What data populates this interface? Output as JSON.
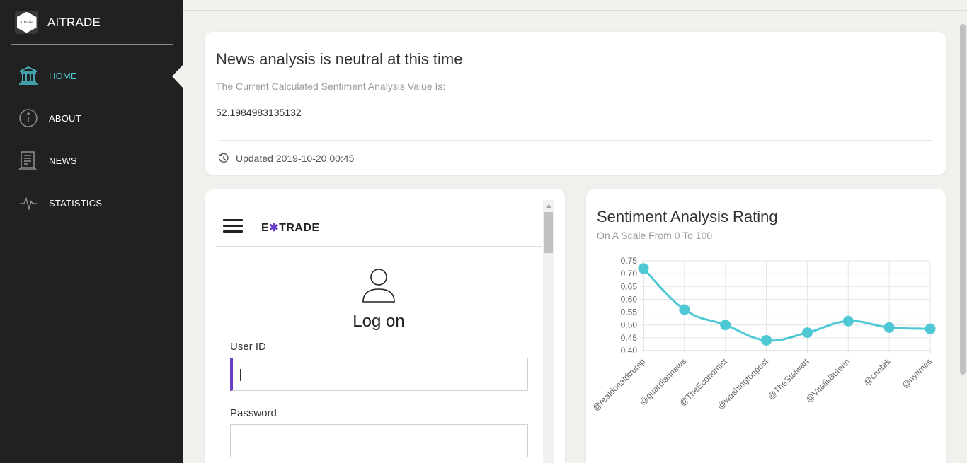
{
  "brand": {
    "name": "AITRADE",
    "logo_text": "AItrade"
  },
  "nav": [
    {
      "label": "HOME",
      "icon": "bank-icon",
      "active": true
    },
    {
      "label": "ABOUT",
      "icon": "info-icon",
      "active": false
    },
    {
      "label": "NEWS",
      "icon": "newspaper-icon",
      "active": false
    },
    {
      "label": "STATISTICS",
      "icon": "pulse-icon",
      "active": false
    }
  ],
  "news_card": {
    "title": "News analysis is neutral at this time",
    "subtitle": "The Current Calculated Sentiment Analysis Value Is:",
    "value": "52.1984983135132",
    "updated": "Updated 2019-10-20 00:45"
  },
  "login_frame": {
    "logo_prefix": "E",
    "logo_star": "✱",
    "logo_suffix": "TRADE",
    "title": "Log on",
    "user_id_label": "User ID",
    "user_id_value": "",
    "password_label": "Password",
    "password_value": ""
  },
  "chart_card": {
    "title": "Sentiment Analysis Rating",
    "subtitle": "On A Scale From 0 To 100"
  },
  "colors": {
    "sidebar_bg": "#212121",
    "accent": "#4ec8d4",
    "page_bg": "#f1f0ed",
    "focus": "#6a3ec8"
  },
  "chart_data": {
    "type": "line",
    "title": "Sentiment Analysis Rating",
    "subtitle": "On A Scale From 0 To 100",
    "categories": [
      "@realdonaldtrump",
      "@guardiannews",
      "@TheEconomist",
      "@washingtonpost",
      "@TheStalwart",
      "@VitalikButerin",
      "@cnnbrk",
      "@nytimes"
    ],
    "series": [
      {
        "values": [
          0.72,
          0.56,
          0.5,
          0.44,
          0.47,
          0.515,
          0.49,
          0.485
        ],
        "color": "#4ec8d4"
      }
    ],
    "ylim": [
      0.4,
      0.75
    ],
    "yticks": [
      "0.75",
      "0.70",
      "0.65",
      "0.60",
      "0.55",
      "0.50",
      "0.45",
      "0.40"
    ],
    "grid": true
  }
}
